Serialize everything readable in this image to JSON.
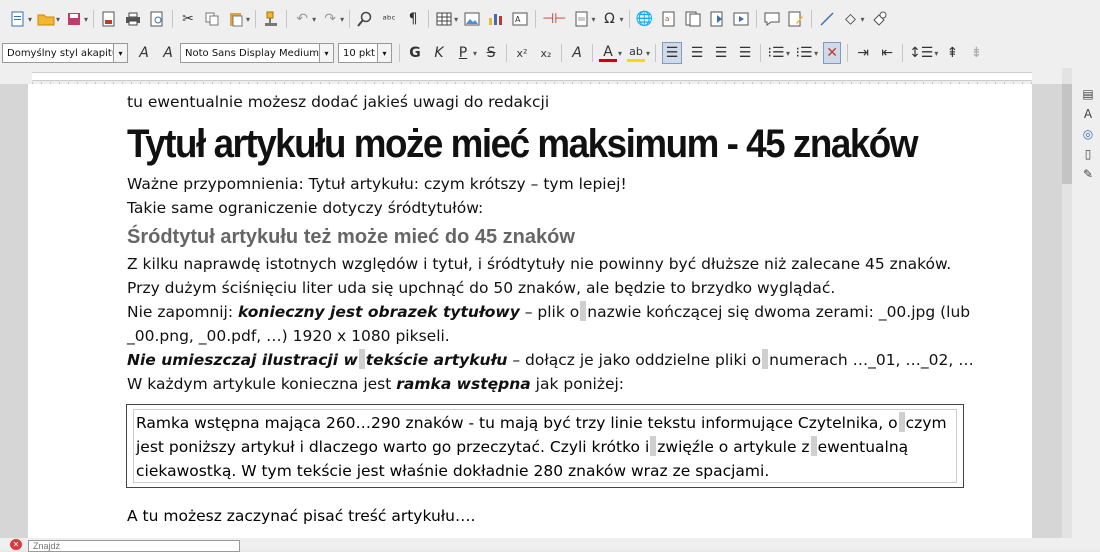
{
  "toolbar": {
    "paragraph_style": "Domyślny styl akapitu",
    "font_name": "Noto Sans Display Medium",
    "font_size": "10 pkt"
  },
  "document": {
    "line1": "tu ewentualnie możesz dodać jakieś uwagi do redakcji",
    "title": "Tytuł artykułu może mieć maksimum - 45 znaków",
    "reminder1": "Ważne przypomnienia: Tytuł artykułu: czym krótszy – tym lepiej!",
    "reminder2": "Takie same ograniczenie dotyczy śródtytułów:",
    "subtitle": "Śródtytuł artykułu też może mieć do 45 znaków",
    "para1": "Z kilku naprawdę istotnych względów i tytuł, i śródtytuły nie powinny być dłuższe niż zalecane 45 znaków.",
    "para2": "Przy dużym ściśnięciu liter uda się upchnąć do 50 znaków, ale będzie to brzydko wyglądać.",
    "para3_a": "Nie zapomnij: ",
    "para3_b": "konieczny jest obrazek tytułowy",
    "para3_c": " – plik o",
    "para3_d": "nazwie kończącej się dwoma zerami: _00.jpg (lub",
    "para4": "_00.png, _00.pdf, …) 1920 x 1080 pikseli.",
    "para5_a": "Nie umieszczaj ilustracji w",
    "para5_b": "tekście artykułu",
    "para5_c": " – dołącz je jako oddzielne pliki o",
    "para5_d": "numerach …_01, …_02, …",
    "para6_a": "W każdym artykule konieczna jest ",
    "para6_b": "ramka wstępna",
    "para6_c": " jak poniżej:",
    "frame1_a": "Ramka wstępna mająca 260…290 znaków - tu mają być trzy linie tekstu informujące Czytelnika, o",
    "frame1_b": "czym",
    "frame2_a": "jest poniższy artykuł i dlaczego warto go przeczytać. Czyli krótko i",
    "frame2_b": "zwięźle o artykule z",
    "frame2_c": "ewentualną",
    "frame3": "ciekawostką. W tym tekście jest właśnie dokładnie 280 znaków wraz ze spacjami.",
    "closing": "A tu możesz zaczynać pisać treść artykułu…."
  },
  "findbar": {
    "placeholder": "Znajdź"
  },
  "colors": {
    "toolbar_bg": "#efefef",
    "page_bg": "#ffffff",
    "canvas_bg": "#d6d6d6",
    "subtitle": "#666666",
    "font_color_accent": "#d10000",
    "highlight_accent": "#ffd800"
  }
}
